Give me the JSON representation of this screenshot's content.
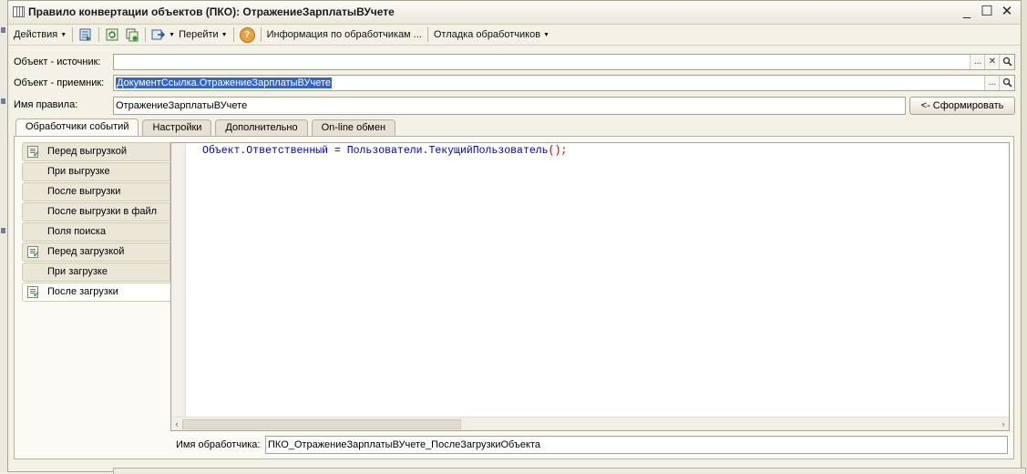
{
  "window": {
    "title": "Правило конвертации объектов (ПКО): ОтражениеЗарплатыВУчете",
    "controls": [
      "_",
      "☐",
      "✕"
    ]
  },
  "toolbar": {
    "actions_label": "Действия",
    "goto_label": "Перейти",
    "help_label": "?",
    "handlers_info_label": "Информация по обработчикам ...",
    "debug_label": "Отладка обработчиков"
  },
  "form": {
    "source_label": "Объект - источник:",
    "source_value": "",
    "target_label": "Объект - приемник:",
    "target_value": "ДокументСсылка.ОтражениеЗарплатыВУчете",
    "rule_name_label": "Имя правила:",
    "rule_name_value": "ОтражениеЗарплатыВУчете",
    "generate_button": "<- Сформировать"
  },
  "field_buttons": {
    "select": "...",
    "clear": "✕"
  },
  "tabs": [
    {
      "label": "Обработчики событий",
      "active": true
    },
    {
      "label": "Настройки",
      "active": false
    },
    {
      "label": "Дополнительно",
      "active": false
    },
    {
      "label": "On-line обмен",
      "active": false
    }
  ],
  "events": [
    {
      "label": "Перед выгрузкой",
      "has_handler": true,
      "selected": false
    },
    {
      "label": "При выгрузке",
      "has_handler": false,
      "selected": false
    },
    {
      "label": "После выгрузки",
      "has_handler": false,
      "selected": false
    },
    {
      "label": "После выгрузки в файл",
      "has_handler": false,
      "selected": false
    },
    {
      "label": "Поля поиска",
      "has_handler": false,
      "selected": false
    },
    {
      "label": "Перед загрузкой",
      "has_handler": true,
      "selected": false
    },
    {
      "label": "При загрузке",
      "has_handler": false,
      "selected": false
    },
    {
      "label": "После загрузки",
      "has_handler": true,
      "selected": true
    }
  ],
  "editor": {
    "code_main": "Объект.Ответственный = Пользователи.ТекущийПользователь",
    "code_tail": "();"
  },
  "handler": {
    "label": "Имя обработчика:",
    "value": "ПКО_ОтражениеЗарплатыВУчете_ПослеЗагрузкиОбъекта"
  }
}
